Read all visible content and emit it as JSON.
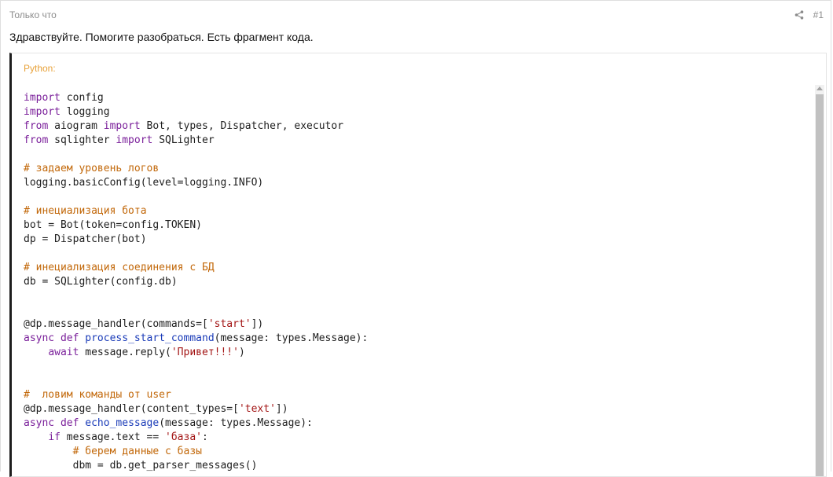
{
  "post": {
    "time": "Только что",
    "number": "#1",
    "share_icon": "share-icon",
    "text": "Здравствуйте. Помогите разобраться. Есть фрагмент кода."
  },
  "code_block": {
    "title": "Python:",
    "language": "python",
    "lines": [
      "import config",
      "import logging",
      "from aiogram import Bot, types, Dispatcher, executor",
      "from sqlighter import SQLighter",
      "",
      "# задаем уровень логов",
      "logging.basicConfig(level=logging.INFO)",
      "",
      "# инециализация бота",
      "bot = Bot(token=config.TOKEN)",
      "dp = Dispatcher(bot)",
      "",
      "# инециализация соединения с БД",
      "db = SQLighter(config.db)",
      "",
      "",
      "@dp.message_handler(commands=['start'])",
      "async def process_start_command(message: types.Message):",
      "    await message.reply('Привет!!!')",
      "",
      "",
      "#  ловим команды от user",
      "@dp.message_handler(content_types=['text'])",
      "async def echo_message(message: types.Message):",
      "    if message.text == 'база':",
      "        # берем данные с базы",
      "        dbm = db.get_parser_messages()"
    ]
  },
  "colors": {
    "keyword": "#7a1f9a",
    "comment": "#c2680a",
    "string": "#a31515",
    "function": "#1a3bb8",
    "title_accent": "#e8a23a"
  }
}
